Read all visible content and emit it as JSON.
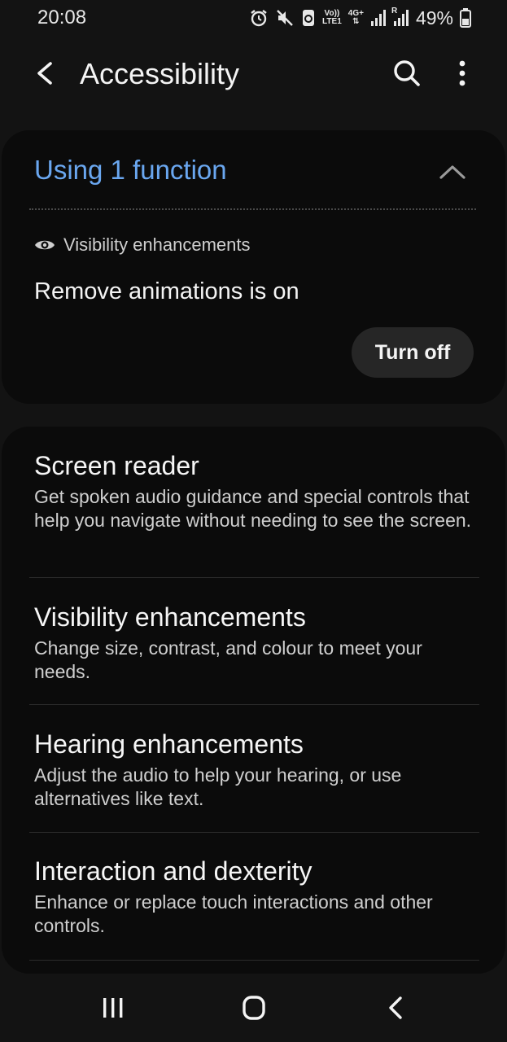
{
  "status_bar": {
    "time": "20:08",
    "icons": [
      "alarm-icon",
      "mute-icon",
      "data-saver-icon",
      "volte-icon",
      "4g-icon",
      "signal-icon",
      "roaming-signal-icon",
      "battery-icon"
    ],
    "volte_label_top": "Vo))",
    "volte_label_bottom": "LTE1",
    "network_label": "4G+",
    "roaming_label": "R",
    "battery_percent": "49%"
  },
  "app_bar": {
    "title": "Accessibility",
    "icons": [
      "back-arrow-icon",
      "search-icon",
      "more-vertical-icon"
    ]
  },
  "active_functions": {
    "header": "Using 1 function",
    "category_label": "Visibility enhancements",
    "status_text": "Remove animations is on",
    "turn_off_label": "Turn off"
  },
  "menu": {
    "items": [
      {
        "title": "Screen reader",
        "description": "Get spoken audio guidance and special controls that help you navigate without needing to see the screen."
      },
      {
        "title": "Visibility enhancements",
        "description": "Change size, contrast, and colour to meet your needs."
      },
      {
        "title": "Hearing enhancements",
        "description": "Adjust the audio to help your hearing, or use alternatives like text."
      },
      {
        "title": "Interaction and dexterity",
        "description": "Enhance or replace touch interactions and other controls."
      }
    ]
  },
  "colors": {
    "background": "#131313",
    "card": "#0b0b0b",
    "accent": "#6aa7f0",
    "button": "#262626"
  },
  "nav_bar": {
    "icons": [
      "recents-icon",
      "home-icon",
      "back-icon"
    ]
  }
}
